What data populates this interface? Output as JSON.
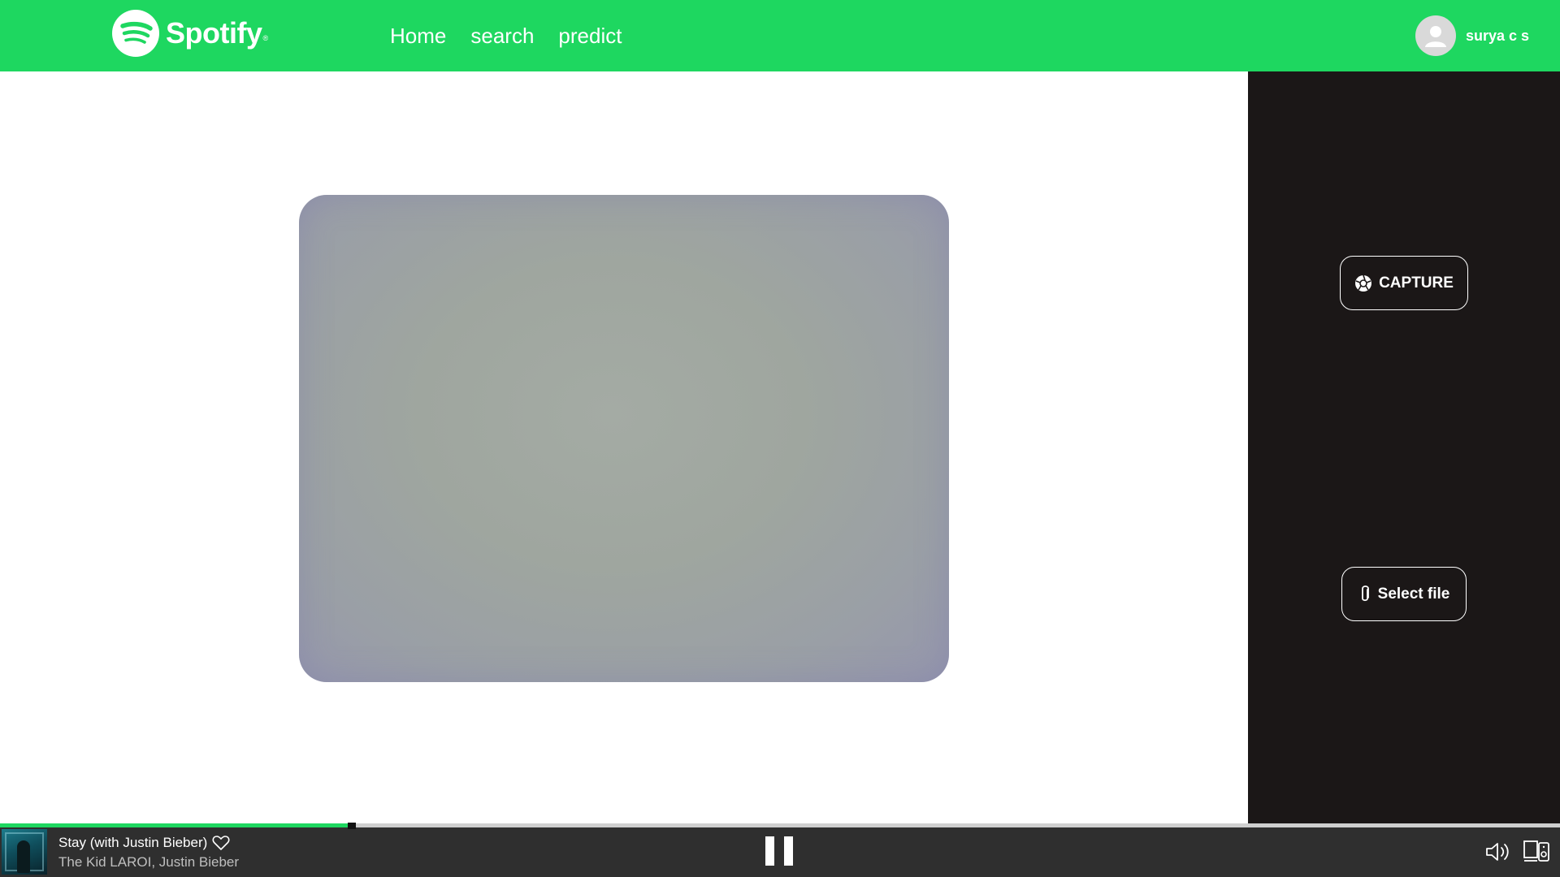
{
  "header": {
    "brand": "Spotify",
    "nav": [
      "Home",
      "search",
      "predict"
    ],
    "user_name": "surya c s",
    "accent_color": "#1ed760"
  },
  "camera": {
    "icon": "camera-preview"
  },
  "sidebar": {
    "capture_label": "CAPTURE",
    "select_file_label": "Select file"
  },
  "player": {
    "track_title": "Stay (with Justin Bieber)",
    "track_artist": "The Kid LAROI, Justin Bieber",
    "progress_fraction": 0.225
  }
}
